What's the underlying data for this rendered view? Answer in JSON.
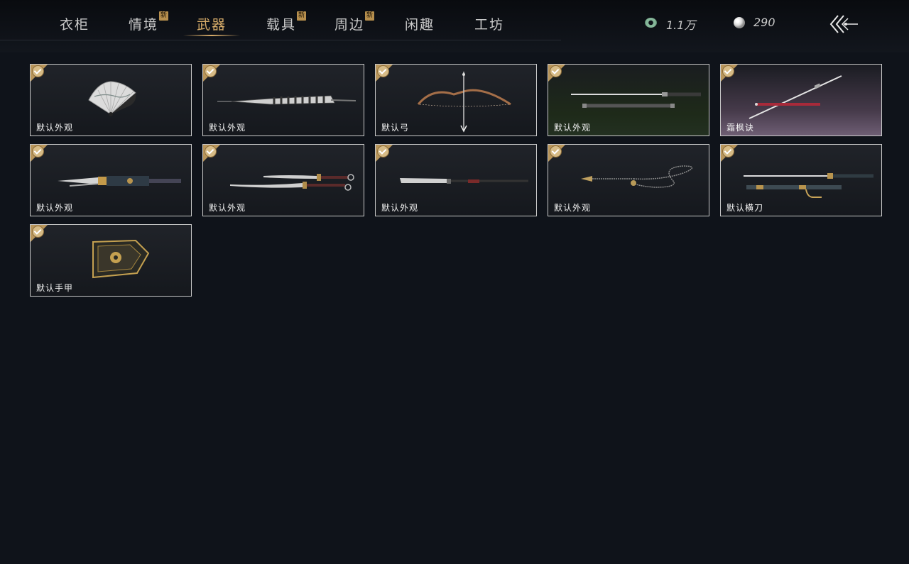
{
  "tabs": [
    {
      "label": "衣柜",
      "new": false,
      "active": false
    },
    {
      "label": "情境",
      "new": true,
      "active": false
    },
    {
      "label": "武器",
      "new": false,
      "active": true
    },
    {
      "label": "载具",
      "new": true,
      "active": false
    },
    {
      "label": "周边",
      "new": true,
      "active": false
    },
    {
      "label": "闲趣",
      "new": false,
      "active": false
    },
    {
      "label": "工坊",
      "new": false,
      "active": false
    }
  ],
  "new_badge": "新",
  "currency": {
    "coins": {
      "value": "1.1万",
      "icon": "jade-coin-icon"
    },
    "pearls": {
      "value": "290",
      "icon": "pearl-icon"
    }
  },
  "back_icon": "back-arrow-icon",
  "items": [
    {
      "label": "默认外观",
      "image": "folding-fan",
      "equipped": true
    },
    {
      "label": "默认外观",
      "image": "umbrella-spear",
      "equipped": true
    },
    {
      "label": "默认弓",
      "image": "bow-and-arrow",
      "equipped": true
    },
    {
      "label": "默认外观",
      "image": "twin-swords",
      "equipped": true
    },
    {
      "label": "霜枫诀",
      "image": "jade-sword",
      "equipped": true
    },
    {
      "label": "默认外观",
      "image": "ornate-blade",
      "equipped": true
    },
    {
      "label": "默认外观",
      "image": "twin-sabres",
      "equipped": true
    },
    {
      "label": "默认外观",
      "image": "glaive",
      "equipped": true
    },
    {
      "label": "默认外观",
      "image": "rope-dart",
      "equipped": true
    },
    {
      "label": "默认横刀",
      "image": "hengdao",
      "equipped": true
    },
    {
      "label": "默认手甲",
      "image": "gauntlet",
      "equipped": true
    }
  ],
  "colors": {
    "accent": "#d8ad6a",
    "badge": "#b78f4d",
    "check": "#b8955a",
    "background": "#0f131a"
  }
}
